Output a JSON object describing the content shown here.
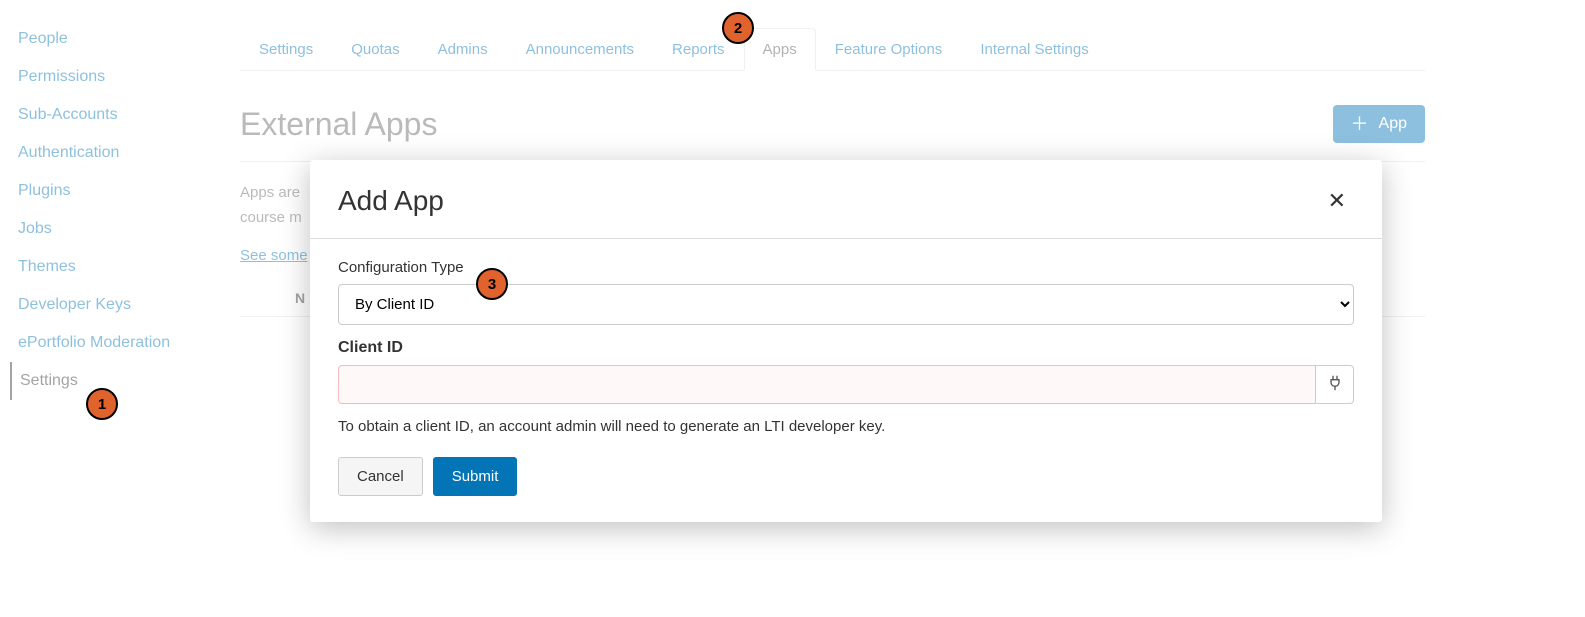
{
  "sidebar": {
    "items": [
      {
        "label": "People"
      },
      {
        "label": "Permissions"
      },
      {
        "label": "Sub-Accounts"
      },
      {
        "label": "Authentication"
      },
      {
        "label": "Plugins"
      },
      {
        "label": "Jobs"
      },
      {
        "label": "Themes"
      },
      {
        "label": "Developer Keys"
      },
      {
        "label": "ePortfolio Moderation"
      },
      {
        "label": "Settings"
      }
    ]
  },
  "tabs": {
    "items": [
      {
        "label": "Settings"
      },
      {
        "label": "Quotas"
      },
      {
        "label": "Admins"
      },
      {
        "label": "Announcements"
      },
      {
        "label": "Reports"
      },
      {
        "label": "Apps"
      },
      {
        "label": "Feature Options"
      },
      {
        "label": "Internal Settings"
      }
    ]
  },
  "page": {
    "title": "External Apps",
    "add_button": "App",
    "desc_line1": "Apps are",
    "desc_line2": "course m",
    "see_link": "See some",
    "table_name_col": "N"
  },
  "modal": {
    "title": "Add App",
    "config_type_label": "Configuration Type",
    "config_type_selected": "By Client ID",
    "client_id_label": "Client ID",
    "client_id_value": "",
    "hint": "To obtain a client ID, an account admin will need to generate an LTI developer key.",
    "cancel": "Cancel",
    "submit": "Submit"
  },
  "steps": {
    "s1": "1",
    "s2": "2",
    "s3": "3"
  }
}
